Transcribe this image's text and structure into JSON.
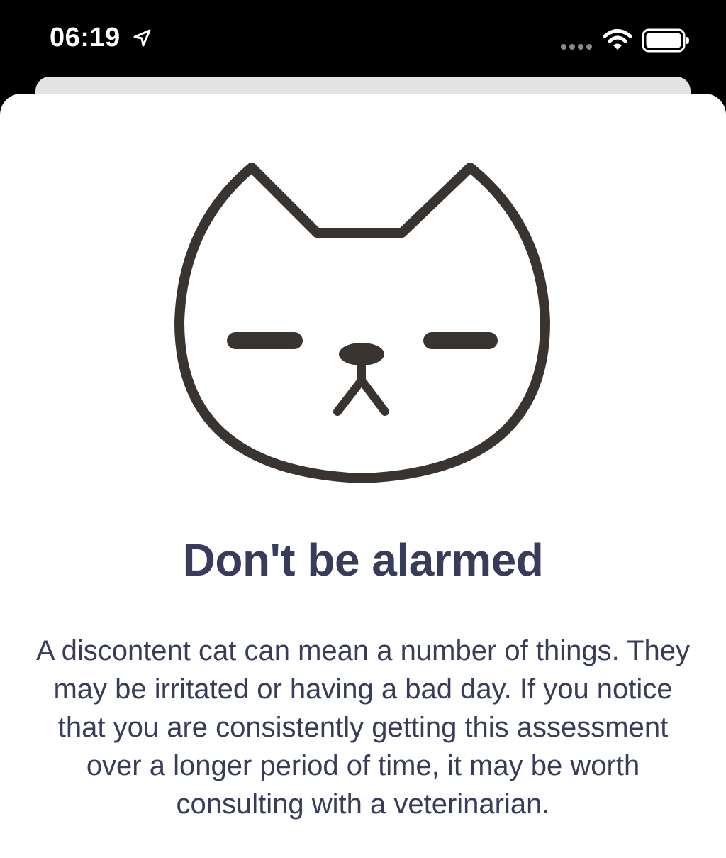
{
  "status_bar": {
    "time": "06:19",
    "icons": [
      "location-arrow-icon",
      "cellular-signal-icon",
      "wifi-icon",
      "battery-icon"
    ]
  },
  "modal": {
    "illustration": "discontent-cat-face-icon",
    "title": "Don't be alarmed",
    "body": "A discontent cat can mean a number of things. They may be irritated or having a bad day. If you notice that you are consistently getting this assessment over a longer period of time, it may be worth consulting with a veterinarian."
  },
  "colors": {
    "text": "#363c5a",
    "illustration_stroke": "#3a3430",
    "sheet_background": "#ffffff",
    "back_sheet": "#e3e3e3",
    "status_bar_background": "#000000"
  }
}
